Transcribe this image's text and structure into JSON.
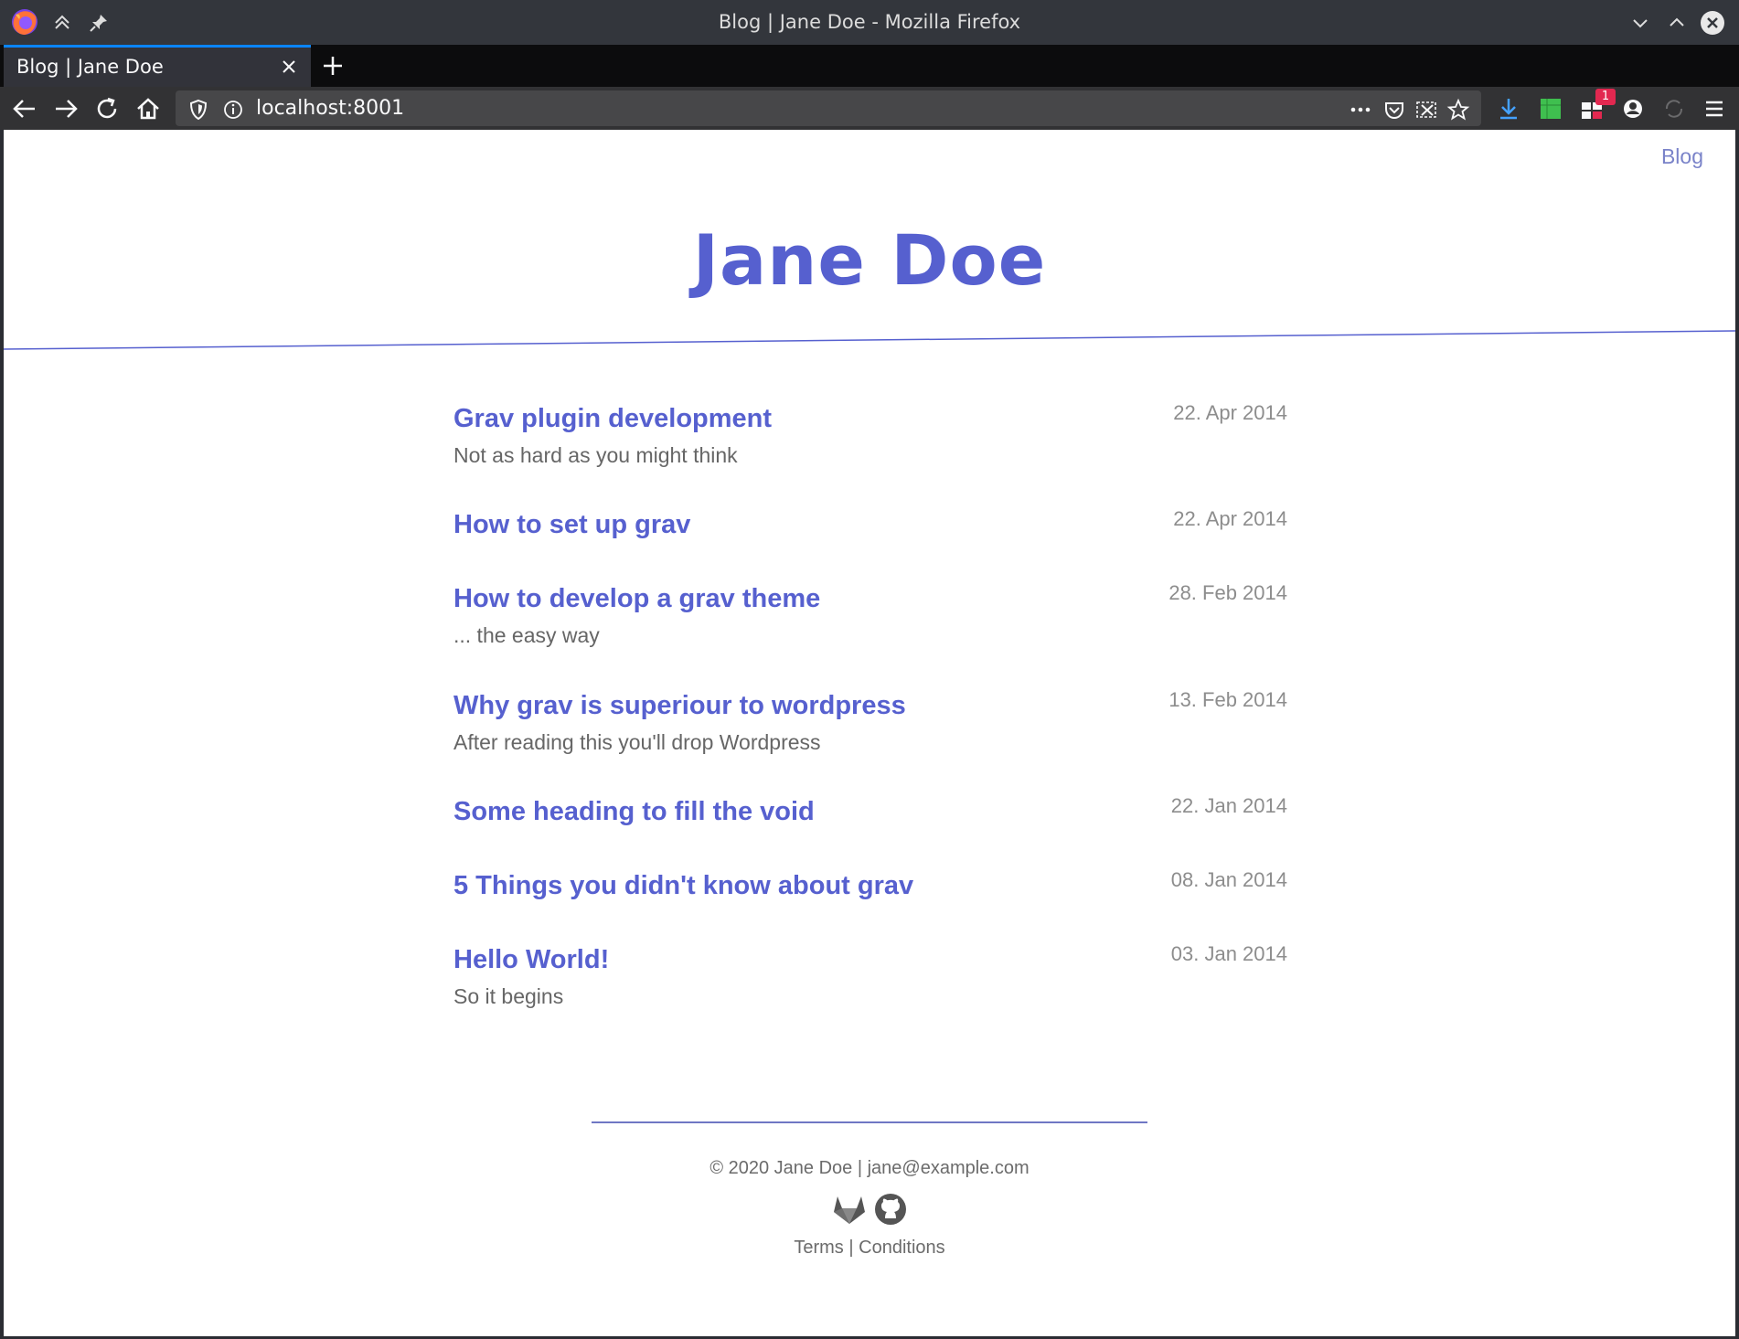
{
  "window": {
    "title": "Blog | Jane Doe - Mozilla Firefox"
  },
  "tabs": [
    {
      "label": "Blog | Jane Doe",
      "active": true
    }
  ],
  "navbar": {
    "url": "localhost:8001",
    "notification_badge": "1"
  },
  "page": {
    "nav_link": "Blog",
    "site_title": "Jane Doe",
    "accent_color": "#5660cf",
    "posts": [
      {
        "title": "Grav plugin development",
        "subtitle": "Not as hard as you might think",
        "date": "22. Apr 2014"
      },
      {
        "title": "How to set up grav",
        "subtitle": "",
        "date": "22. Apr 2014"
      },
      {
        "title": "How to develop a grav theme",
        "subtitle": "... the easy way",
        "date": "28. Feb 2014"
      },
      {
        "title": "Why grav is superiour to wordpress",
        "subtitle": "After reading this you'll drop Wordpress",
        "date": "13. Feb 2014"
      },
      {
        "title": "Some heading to fill the void",
        "subtitle": "",
        "date": "22. Jan 2014"
      },
      {
        "title": "5 Things you didn't know about grav",
        "subtitle": "",
        "date": "08. Jan 2014"
      },
      {
        "title": "Hello World!",
        "subtitle": "So it begins",
        "date": "03. Jan 2014"
      }
    ],
    "footer": {
      "copyright": "© 2020 Jane Doe | jane@example.com",
      "terms": "Terms",
      "separator": "|",
      "conditions": "Conditions",
      "icons": [
        "gitlab-icon",
        "github-icon"
      ]
    }
  }
}
